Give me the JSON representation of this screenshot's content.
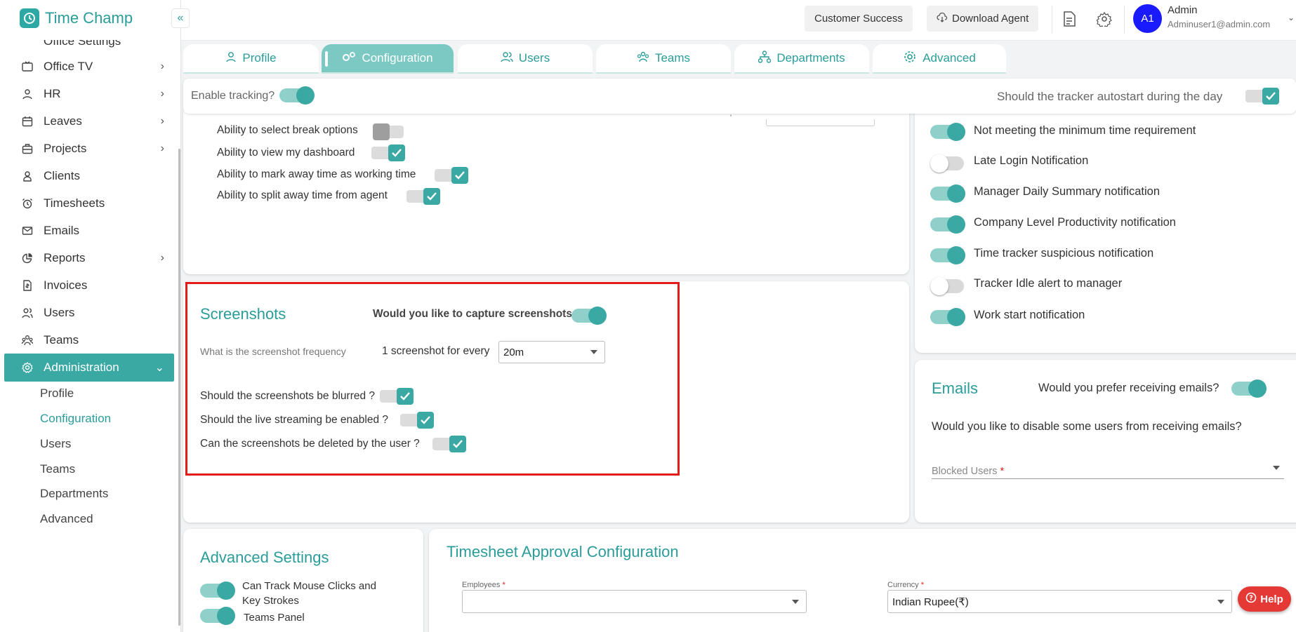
{
  "app": {
    "name": "Time Champ",
    "collapse_icon": "«"
  },
  "sidebar": {
    "partial_label": "Office Settings",
    "items": [
      {
        "label": "Office TV",
        "icon": "tv-icon",
        "chevron": "›"
      },
      {
        "label": "HR",
        "icon": "person-icon",
        "chevron": "›"
      },
      {
        "label": "Leaves",
        "icon": "calendar-icon",
        "chevron": "›"
      },
      {
        "label": "Projects",
        "icon": "briefcase-icon",
        "chevron": "›"
      },
      {
        "label": "Clients",
        "icon": "client-icon",
        "chevron": ""
      },
      {
        "label": "Timesheets",
        "icon": "alarm-icon",
        "chevron": ""
      },
      {
        "label": "Emails",
        "icon": "mail-icon",
        "chevron": ""
      },
      {
        "label": "Reports",
        "icon": "pie-icon",
        "chevron": "›"
      },
      {
        "label": "Invoices",
        "icon": "invoice-icon",
        "chevron": ""
      },
      {
        "label": "Users",
        "icon": "users-icon",
        "chevron": ""
      },
      {
        "label": "Teams",
        "icon": "teams-icon",
        "chevron": ""
      },
      {
        "label": "Administration",
        "icon": "gear-icon",
        "chevron": "⌄"
      }
    ],
    "subitems": [
      "Profile",
      "Configuration",
      "Users",
      "Teams",
      "Departments",
      "Advanced"
    ]
  },
  "topbar": {
    "customer_success": "Customer Success",
    "download_agent": "Download Agent",
    "avatar_initials": "A1",
    "user_name": "Admin",
    "user_email": "Adminuser1@admin.com"
  },
  "tabs": [
    "Profile",
    "Configuration",
    "Users",
    "Teams",
    "Departments",
    "Advanced"
  ],
  "tracking": {
    "enable_label": "Enable tracking?",
    "enable_on": true,
    "autostart_label": "Should the tracker autostart during the day",
    "autostart_on": true
  },
  "abilities": [
    {
      "label": "Ability to select break options",
      "checked": false
    },
    {
      "label": "Ability to view my dashboard",
      "checked": true
    },
    {
      "label": "Ability to mark away time as working time",
      "checked": true
    },
    {
      "label": "Ability to split away time from agent",
      "checked": true
    }
  ],
  "notifications": [
    {
      "label": "Not meeting the minimum time requirement",
      "on": true
    },
    {
      "label": "Late Login Notification",
      "on": false
    },
    {
      "label": "Manager Daily Summary notification",
      "on": true
    },
    {
      "label": "Company Level Productivity notification",
      "on": true
    },
    {
      "label": "Time tracker suspicious notification",
      "on": true
    },
    {
      "label": "Tracker Idle alert to manager",
      "on": false
    },
    {
      "label": "Work start notification",
      "on": true
    }
  ],
  "screenshots": {
    "title": "Screenshots",
    "capture_label": "Would you like to capture screenshots",
    "capture_on": true,
    "frequency_label": "What is the screenshot frequency",
    "frequency_prefix": "1 screenshot for every",
    "frequency_value": "20m",
    "blurred_label": "Should the screenshots be blurred ?",
    "blurred": true,
    "live_label": "Should the live streaming be enabled ?",
    "live": true,
    "delete_label": "Can the screenshots be deleted by the user ?",
    "delete": true
  },
  "emails": {
    "title": "Emails",
    "prefer_label": "Would you prefer receiving emails?",
    "prefer_on": true,
    "disable_label": "Would you like to disable some users from receiving emails?",
    "blocked_label": "Blocked Users",
    "required_mark": "*"
  },
  "advanced": {
    "title": "Advanced Settings",
    "items": [
      {
        "label": "Can Track Mouse Clicks and Key Strokes",
        "on": true
      },
      {
        "label": "Teams Panel",
        "on": true
      }
    ]
  },
  "timesheet": {
    "title": "Timesheet Approval Configuration",
    "employees_label": "Employees",
    "currency_label": "Currency",
    "currency_value": "Indian Rupee(₹)",
    "required_mark": "*"
  },
  "help": {
    "label": "Help"
  },
  "colors": {
    "accent": "#3aa8a3",
    "accent_light": "#8fd0cb",
    "highlight": "#e31b1b",
    "avatar": "#1a1aff",
    "help": "#e53935"
  }
}
